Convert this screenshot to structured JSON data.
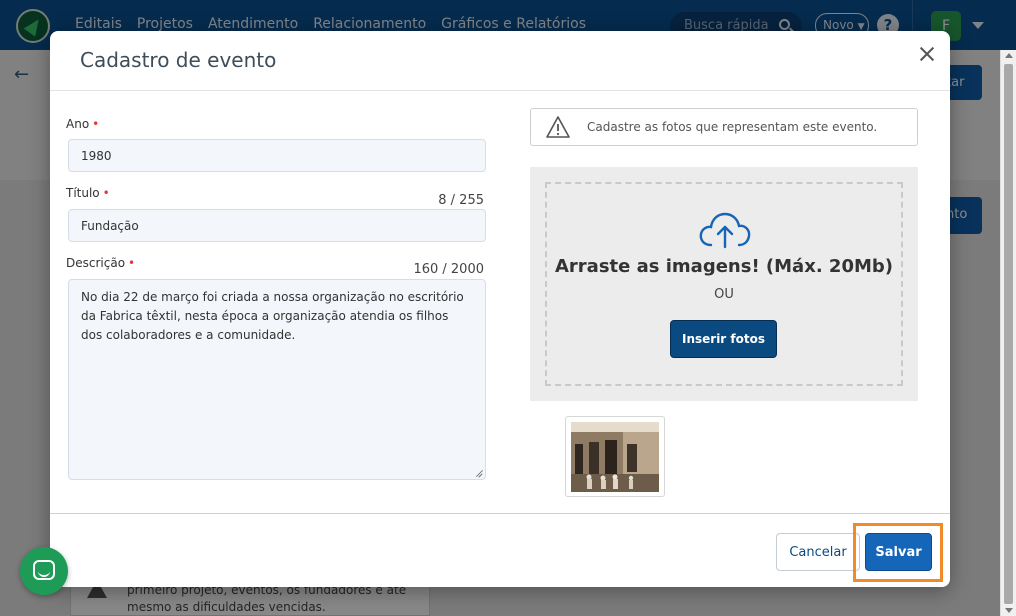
{
  "topbar": {
    "nav_items": [
      "Editais",
      "Projetos",
      "Atendimento",
      "Relacionamento",
      "Gráficos e Relatórios"
    ],
    "quick_search_placeholder": "Busca rápida",
    "new_button": "Novo",
    "help": "?",
    "avatar_initial": "F"
  },
  "background": {
    "button_1": "tar",
    "button_2": "nto",
    "hint_text": "primeiro projeto, eventos, os fundadores e até mesmo as dificuldades vencidas."
  },
  "modal": {
    "title": "Cadastro de evento",
    "required_mark": "•",
    "ano": {
      "label": "Ano",
      "value": "1980"
    },
    "titulo": {
      "label": "Título",
      "counter": "8 / 255",
      "value": "Fundação"
    },
    "descricao": {
      "label": "Descrição",
      "counter": "160 / 2000",
      "value": "No dia 22 de março foi criada a nossa organização no escritório da Fabrica têxtil, nesta época a organização atendia os filhos dos colaboradores e a comunidade."
    },
    "notice_text": "Cadastre as fotos que representam este evento.",
    "dropzone": {
      "title": "Arraste as imagens! (Máx. 20Mb)",
      "or_text": "OU",
      "insert_button": "Inserir fotos"
    },
    "footer": {
      "cancel": "Cancelar",
      "save": "Salvar"
    }
  },
  "colors": {
    "topbar": "#0a4f8f",
    "primary_button": "#1565b8",
    "insert_button": "#0a4a80",
    "highlight": "#f28a2a",
    "required": "#e03a3a",
    "chat": "#1e9b57"
  }
}
